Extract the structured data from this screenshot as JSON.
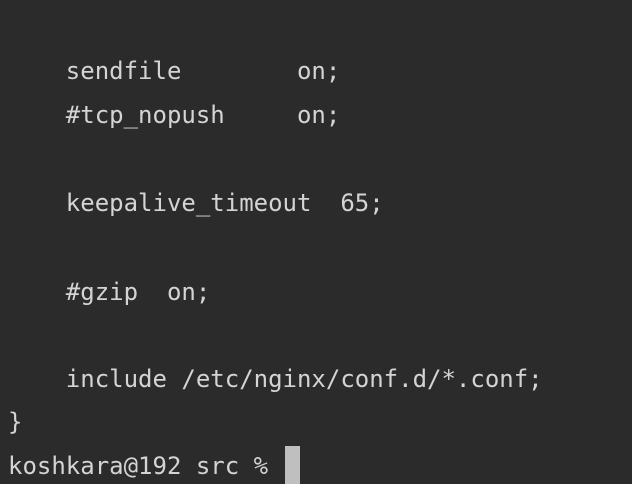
{
  "terminal": {
    "lines": [
      "    sendfile        on;",
      "    #tcp_nopush     on;",
      "",
      "    keepalive_timeout  65;",
      "",
      "    #gzip  on;",
      "",
      "    include /etc/nginx/conf.d/*.conf;",
      "}"
    ],
    "prompt": "koshkara@192 src % "
  },
  "colors": {
    "background": "#2b2b2b",
    "text": "#d4d4d4",
    "cursor": "#bfbfbf"
  }
}
